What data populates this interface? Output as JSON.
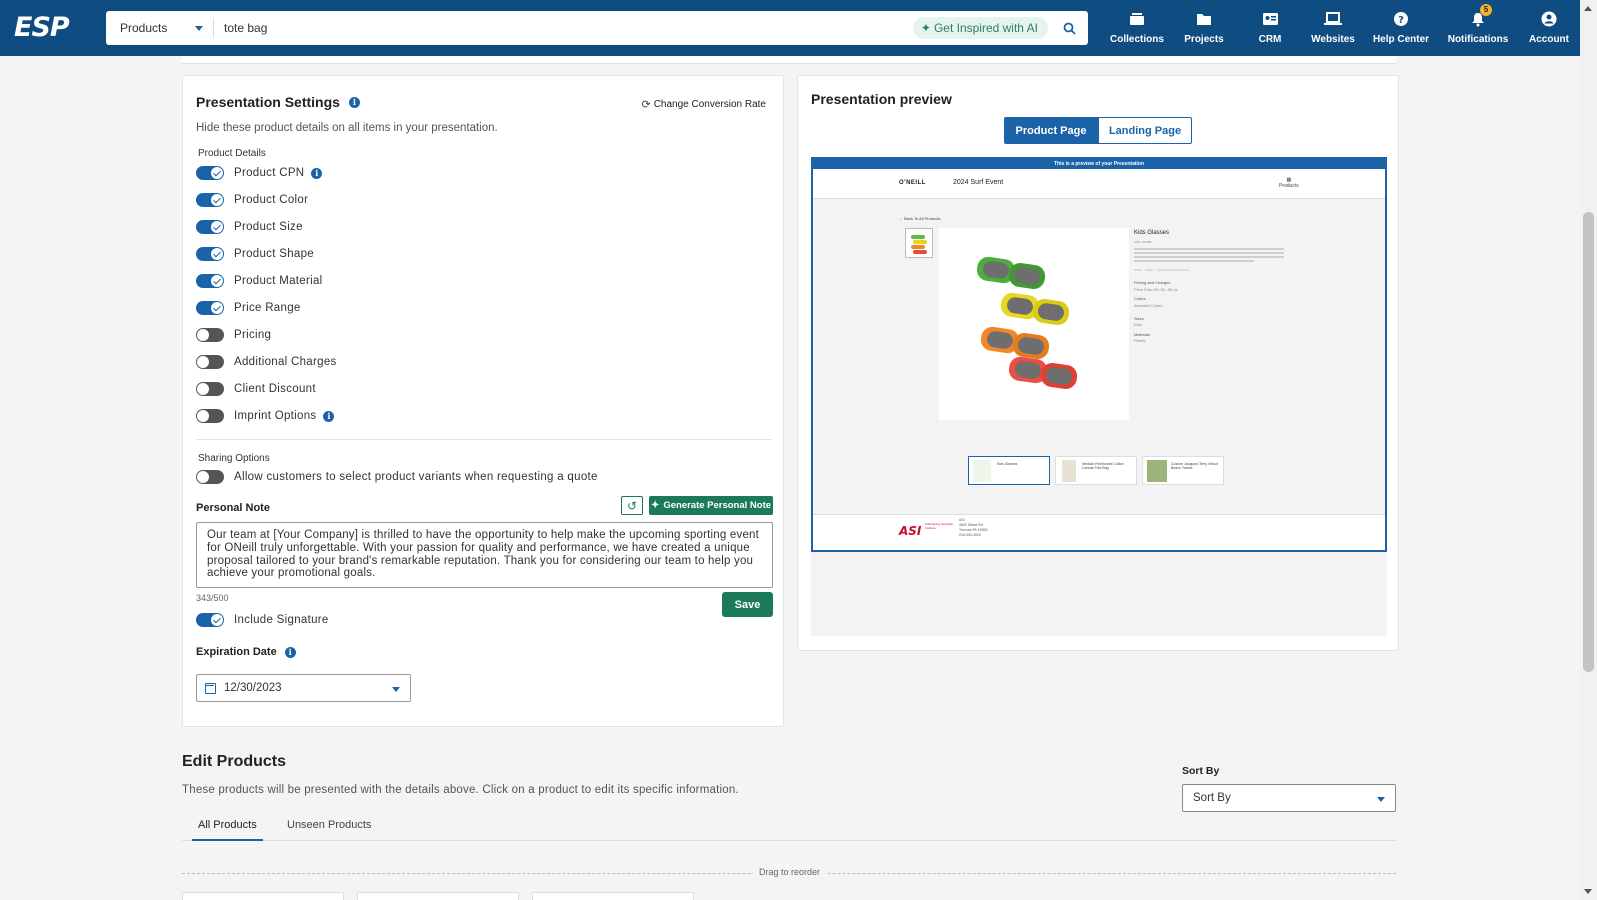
{
  "header": {
    "logo": "ESP",
    "search": {
      "category": "Products",
      "query": "tote bag",
      "ai_label": "Get Inspired with AI"
    },
    "nav": [
      {
        "label": "Collections",
        "icon": "collections-icon"
      },
      {
        "label": "Projects",
        "icon": "folder-icon"
      },
      {
        "label": "CRM",
        "icon": "contact-card-icon"
      },
      {
        "label": "Websites",
        "icon": "laptop-icon"
      },
      {
        "label": "Help Center",
        "icon": "help-icon"
      },
      {
        "label": "Notifications",
        "icon": "bell-icon",
        "badge": "5"
      },
      {
        "label": "Account",
        "icon": "account-icon"
      }
    ]
  },
  "settings": {
    "title": "Presentation Settings",
    "conversion_label": "Change Conversion Rate",
    "hint": "Hide these product details on all items in your presentation.",
    "product_details_label": "Product Details",
    "toggles": [
      {
        "label": "Product CPN",
        "on": true,
        "info": true
      },
      {
        "label": "Product Color",
        "on": true
      },
      {
        "label": "Product Size",
        "on": true
      },
      {
        "label": "Product Shape",
        "on": true
      },
      {
        "label": "Product Material",
        "on": true
      },
      {
        "label": "Price Range",
        "on": true
      },
      {
        "label": "Pricing",
        "on": false
      },
      {
        "label": "Additional Charges",
        "on": false
      },
      {
        "label": "Client Discount",
        "on": false
      },
      {
        "label": "Imprint Options",
        "on": false,
        "info": true
      }
    ],
    "sharing_label": "Sharing Options",
    "sharing_toggle": {
      "label": "Allow customers to select product variants when requesting a quote",
      "on": false
    },
    "personal_note_label": "Personal Note",
    "generate_label": "Generate Personal Note",
    "note_text": "Our team at [Your Company] is thrilled to have the opportunity to help make the upcoming sporting event for ONeill truly unforgettable. With your passion for quality and performance, we have created a unique proposal tailored to your brand's remarkable reputation. Thank you for considering our team to help you achieve your promotional goals.",
    "char_count": "343/500",
    "save_label": "Save",
    "signature_toggle": {
      "label": "Include Signature",
      "on": true
    },
    "expiration_label": "Expiration Date",
    "expiration_value": "12/30/2023"
  },
  "preview": {
    "title": "Presentation preview",
    "tab_product": "Product Page",
    "tab_landing": "Landing Page",
    "banner": "This is a preview of your Presentation",
    "brand": "O'NEILL",
    "event": "2024 Surf Event",
    "nav_item": "Products",
    "back": "← Back To All Products",
    "product_title": "Kids Glasses",
    "cpn": "CPN-720968",
    "pricing_label": "Pricing and Charges",
    "price_from": "Price From $1.36 - $1.xx",
    "colors_label": "Colors",
    "colors_value": "Assorted Colors",
    "sizes_label": "Sizes",
    "sizes_value": "Kids",
    "materials_label": "Materials",
    "materials_value": "Plastic",
    "strip": [
      "Kids Glasses",
      "Medium Reinforced Cotton Canvas Tote Bag",
      "Custom Jacquard Terry Velour Beach Towels"
    ],
    "footer_logo": "ASI",
    "footer_logo_sub": "Advertising Specialty Institute",
    "footer_addr": [
      "ASI",
      "4800 Street Rd",
      "Trevose PA 19053",
      "215-953-3000"
    ]
  },
  "edit_products": {
    "title": "Edit Products",
    "desc": "These products will be presented with the details above. Click on a product to edit its specific information.",
    "sort_label": "Sort By",
    "sort_value": "Sort By",
    "tabs": [
      "All Products",
      "Unseen Products"
    ],
    "drag_label": "Drag to reorder"
  },
  "colors": {
    "topbar": "#0f4c81",
    "primary": "#1b63a8",
    "green": "#1b7a5a"
  }
}
